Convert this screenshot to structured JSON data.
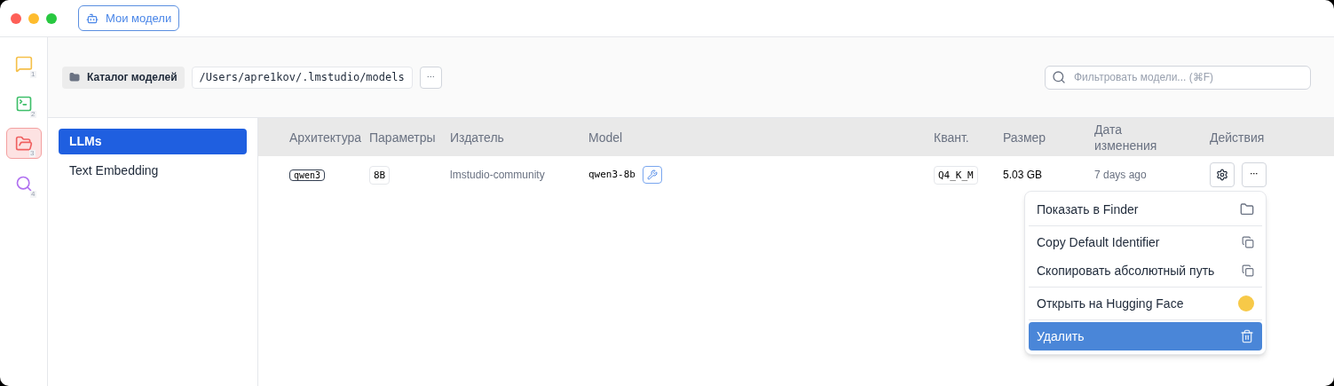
{
  "title_bar": {
    "tab_label": "Мои модели"
  },
  "rail": [
    {
      "kind": "chat",
      "badge": "1",
      "selected": false
    },
    {
      "kind": "terminal",
      "badge": "2",
      "selected": false
    },
    {
      "kind": "folder",
      "badge": "3",
      "selected": true
    },
    {
      "kind": "search",
      "badge": "4",
      "selected": false
    }
  ],
  "toolbar": {
    "catalog_label": "Каталог моделей",
    "path": "/Users/apre1kov/.lmstudio/models",
    "more_button": "···",
    "search": {
      "placeholder": "Фильтровать модели... (⌘F)"
    }
  },
  "sidebar": {
    "items": [
      {
        "label": "LLMs",
        "selected": true
      },
      {
        "label": "Text Embedding",
        "selected": false
      }
    ]
  },
  "table": {
    "columns": [
      "Архитектура",
      "Параметры",
      "Издатель",
      "Model",
      "Квант.",
      "Размер",
      "Дата изменения",
      "Действия"
    ],
    "rows": [
      {
        "architecture": "qwen3",
        "params": "8B",
        "publisher": "lmstudio-community",
        "model": "qwen3-8b",
        "quant": "Q4_K_M",
        "size": "5.03 GB",
        "modified": "7 days ago",
        "more_button": "···"
      }
    ]
  },
  "menu": {
    "groups": [
      {
        "items": [
          {
            "label": "Показать в Finder",
            "kind": "folder",
            "selected": false
          }
        ]
      },
      {
        "items": [
          {
            "label": "Copy Default Identifier",
            "kind": "copy",
            "selected": false
          },
          {
            "label": "Скопировать абсолютный путь",
            "kind": "copy",
            "selected": false
          }
        ]
      },
      {
        "items": [
          {
            "label": "Открыть на Hugging Face",
            "kind": "emoji",
            "selected": false
          }
        ]
      },
      {
        "items": [
          {
            "label": "Удалить",
            "kind": "trash",
            "selected": true
          }
        ]
      }
    ]
  }
}
